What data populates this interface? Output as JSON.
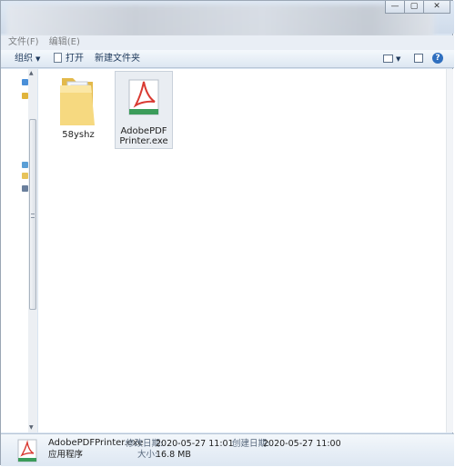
{
  "window": {
    "minimize": "—",
    "maximize": "▢",
    "close": "✕"
  },
  "menubar": {
    "file": "文件(F)",
    "edit": "编辑(E)"
  },
  "toolbar": {
    "organize": "组织",
    "open": "打开",
    "new_folder": "新建文件夹",
    "help": "?"
  },
  "items": [
    {
      "name": "58yshz",
      "type": "folder"
    },
    {
      "name": "AdobePDFPrinter.exe",
      "type": "application",
      "selected": true
    }
  ],
  "details": {
    "name": "AdobePDFPrinter.exe",
    "type": "应用程序",
    "modified_label": "修改日期:",
    "modified_value": "2020-05-27 11:01",
    "created_label": "创建日期:",
    "created_value": "2020-05-27 11:00",
    "size_label": "大小:",
    "size_value": "16.8 MB"
  },
  "colors": {
    "accent": "#d9e4f1",
    "pdf_red": "#d93a32",
    "folder": "#f3d67a"
  }
}
